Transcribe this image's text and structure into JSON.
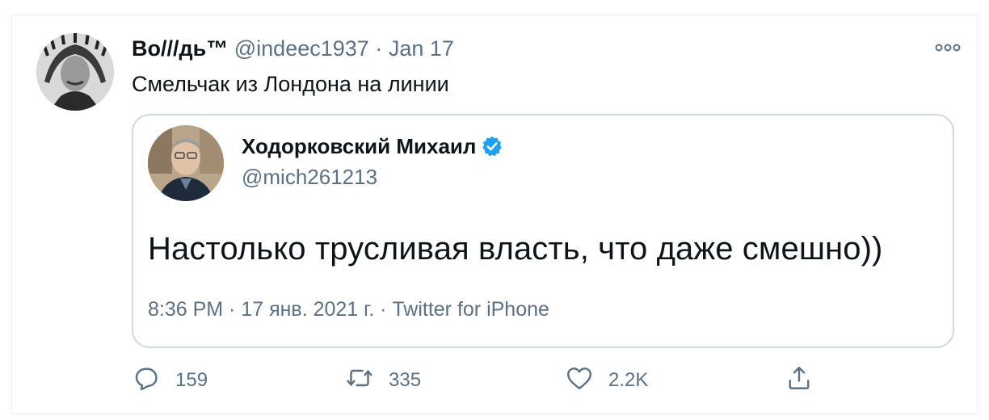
{
  "tweet": {
    "author_name": "Bo///дь™",
    "author_handle": "@indeec1937",
    "separator": "·",
    "date": "Jan 17",
    "text": "Смельчак из Лондона на линии"
  },
  "quoted_tweet": {
    "author_name": "Ходорковский Михаил",
    "author_handle": "@mich261213",
    "verified": true,
    "text": "Настолько трусливая власть, что даже смешно))",
    "meta": "8:36 PM · 17 янв. 2021 г. · Twitter for iPhone"
  },
  "actions": {
    "reply_count": "159",
    "retweet_count": "335",
    "like_count": "2.2K"
  },
  "icons": {
    "more": "more-icon",
    "reply": "reply-icon",
    "retweet": "retweet-icon",
    "like": "heart-icon",
    "share": "share-icon",
    "verified": "verified-badge-icon"
  },
  "colors": {
    "secondary_text": "#5b7083",
    "verified_blue": "#1da1f2",
    "border": "#cfd9de"
  }
}
